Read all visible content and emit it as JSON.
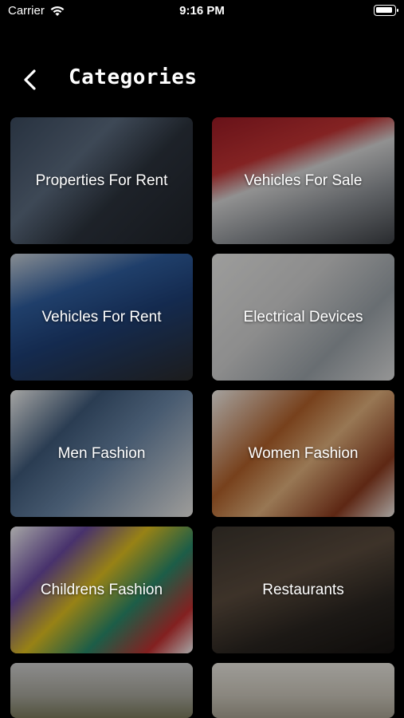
{
  "status_bar": {
    "carrier": "Carrier",
    "time": "9:16 PM"
  },
  "header": {
    "title": "Categories"
  },
  "categories": [
    {
      "label": "Properties For Rent"
    },
    {
      "label": "Vehicles For Sale"
    },
    {
      "label": "Vehicles For Rent"
    },
    {
      "label": "Electrical Devices"
    },
    {
      "label": "Men Fashion"
    },
    {
      "label": "Women Fashion"
    },
    {
      "label": "Childrens Fashion"
    },
    {
      "label": "Restaurants"
    },
    {
      "label": ""
    },
    {
      "label": ""
    }
  ]
}
